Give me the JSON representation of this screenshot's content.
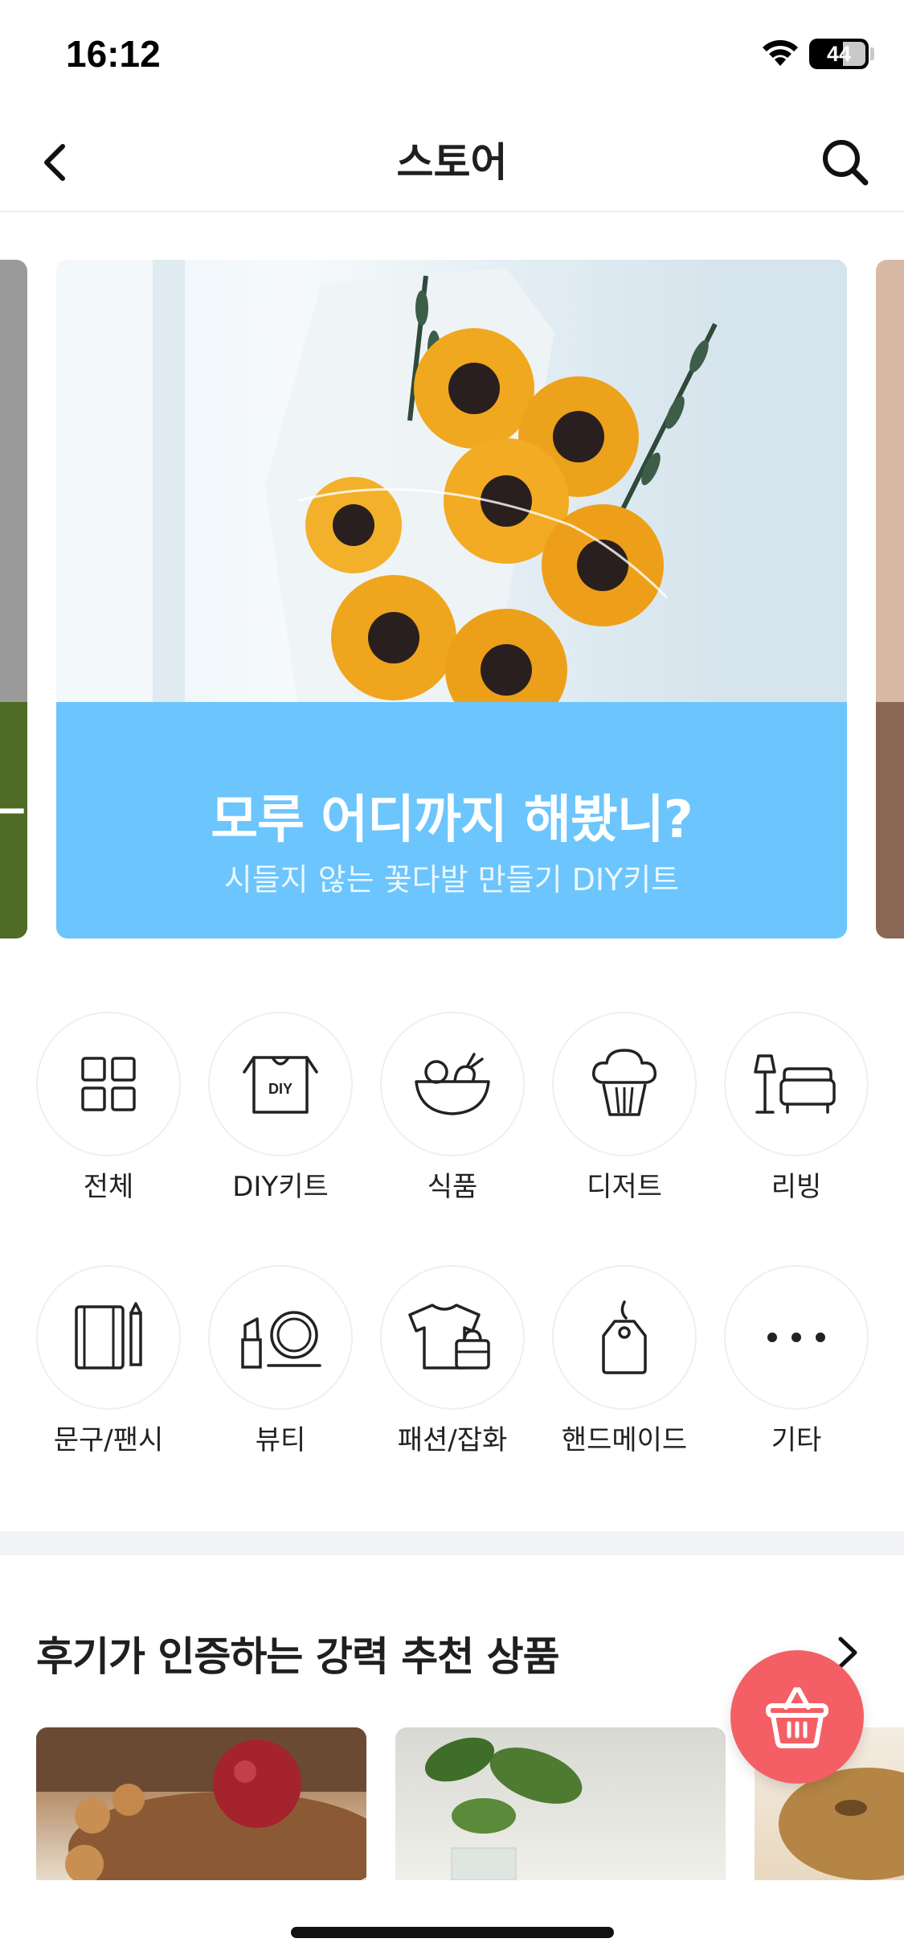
{
  "status_bar": {
    "time": "16:12",
    "battery": "44"
  },
  "nav": {
    "title": "스토어",
    "back_icon": "chevron-left-icon",
    "search_icon": "search-icon"
  },
  "banner": {
    "title": "모루 어디까지 해봤니?",
    "subtitle": "시들지 않는 꽃다발 만들기 DIY키트",
    "accent_color": "#6cc5fd",
    "left_peek_text": "ㅡ"
  },
  "categories": [
    {
      "label": "전체",
      "icon": "grid-icon"
    },
    {
      "label": "DIY키트",
      "icon": "diy-kit-icon",
      "icon_text": "DIY"
    },
    {
      "label": "식품",
      "icon": "food-bowl-icon"
    },
    {
      "label": "디저트",
      "icon": "cupcake-icon"
    },
    {
      "label": "리빙",
      "icon": "sofa-lamp-icon"
    },
    {
      "label": "문구/팬시",
      "icon": "notebook-pencil-icon"
    },
    {
      "label": "뷰티",
      "icon": "cosmetics-icon"
    },
    {
      "label": "패션/잡화",
      "icon": "tshirt-bag-icon"
    },
    {
      "label": "핸드메이드",
      "icon": "tag-icon"
    },
    {
      "label": "기타",
      "icon": "more-icon"
    }
  ],
  "recommend": {
    "title": "후기가 인증하는 강력 추천 상품",
    "more_icon": "chevron-right-icon"
  },
  "fab": {
    "icon": "basket-icon",
    "color": "#f45f66"
  }
}
